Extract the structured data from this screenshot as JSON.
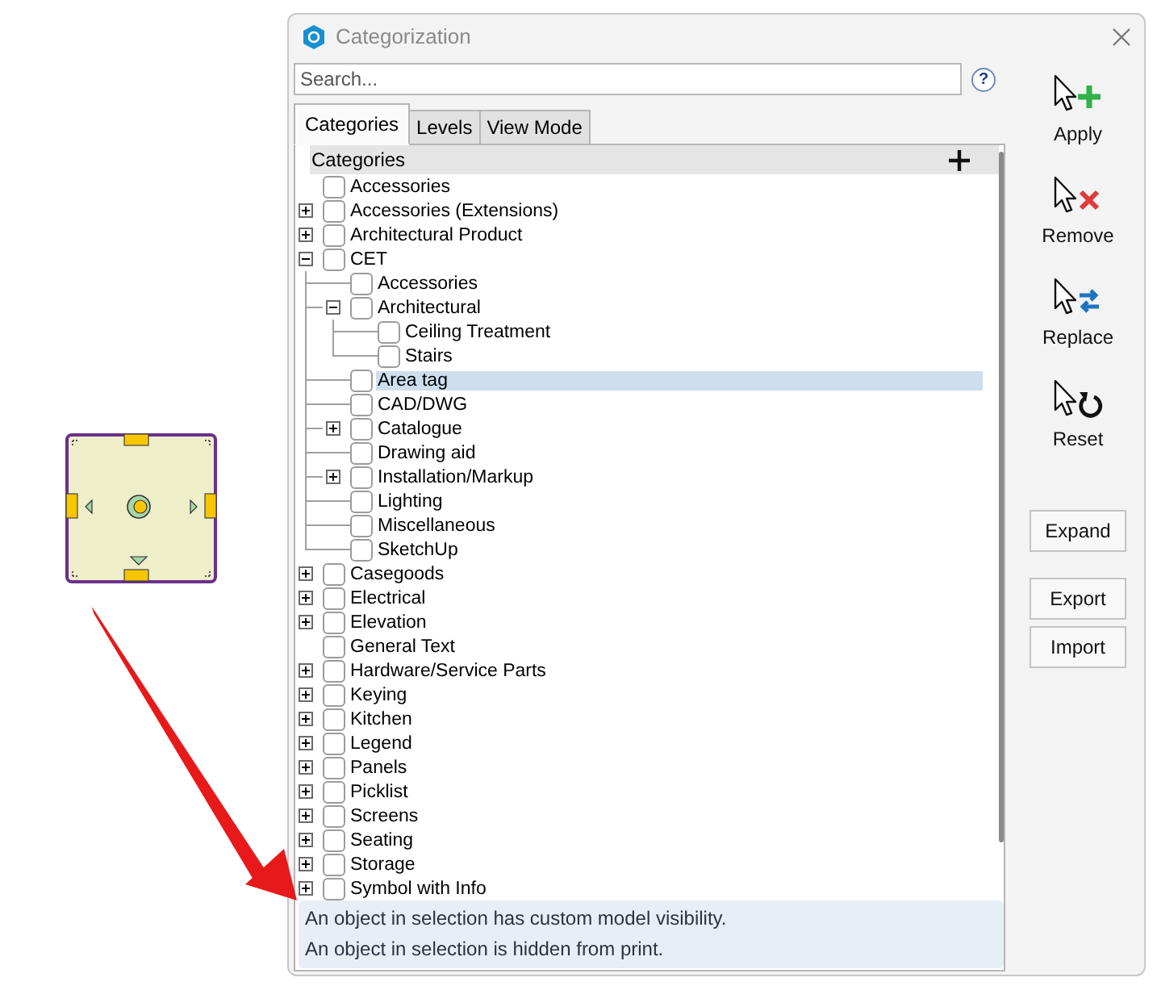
{
  "window": {
    "title": "Categorization"
  },
  "search": {
    "placeholder": "Search..."
  },
  "help_button": {
    "label": "?"
  },
  "tabs": [
    {
      "label": "Categories",
      "selected": true
    },
    {
      "label": "Levels",
      "selected": false
    },
    {
      "label": "View Mode",
      "selected": false
    }
  ],
  "tree": {
    "header": "Categories",
    "items": [
      {
        "label": "Accessories",
        "checked": false,
        "selected": false
      },
      {
        "label": "Accessories (Extensions)",
        "checked": false,
        "selected": false,
        "expanded": false
      },
      {
        "label": "Architectural Product",
        "checked": false,
        "selected": false,
        "expanded": false
      },
      {
        "label": "CET",
        "checked": false,
        "selected": false,
        "expanded": true,
        "children": [
          {
            "label": "Accessories",
            "checked": false,
            "selected": false
          },
          {
            "label": "Architectural",
            "checked": false,
            "selected": false,
            "expanded": true,
            "children": [
              {
                "label": "Ceiling Treatment",
                "checked": false,
                "selected": false
              },
              {
                "label": "Stairs",
                "checked": false,
                "selected": false
              }
            ]
          },
          {
            "label": "Area tag",
            "checked": false,
            "selected": true
          },
          {
            "label": "CAD/DWG",
            "checked": false,
            "selected": false
          },
          {
            "label": "Catalogue",
            "checked": false,
            "selected": false,
            "expanded": false
          },
          {
            "label": "Drawing aid",
            "checked": false,
            "selected": false
          },
          {
            "label": "Installation/Markup",
            "checked": false,
            "selected": false,
            "expanded": false
          },
          {
            "label": "Lighting",
            "checked": false,
            "selected": false
          },
          {
            "label": "Miscellaneous",
            "checked": false,
            "selected": false
          },
          {
            "label": "SketchUp",
            "checked": false,
            "selected": false
          }
        ]
      },
      {
        "label": "Casegoods",
        "checked": false,
        "selected": false,
        "expanded": false
      },
      {
        "label": "Electrical",
        "checked": false,
        "selected": false,
        "expanded": false
      },
      {
        "label": "Elevation",
        "checked": false,
        "selected": false,
        "expanded": false
      },
      {
        "label": "General Text",
        "checked": false,
        "selected": false
      },
      {
        "label": "Hardware/Service Parts",
        "checked": false,
        "selected": false,
        "expanded": false
      },
      {
        "label": "Keying",
        "checked": false,
        "selected": false,
        "expanded": false
      },
      {
        "label": "Kitchen",
        "checked": false,
        "selected": false,
        "expanded": false
      },
      {
        "label": "Legend",
        "checked": false,
        "selected": false,
        "expanded": false
      },
      {
        "label": "Panels",
        "checked": false,
        "selected": false,
        "expanded": false
      },
      {
        "label": "Picklist",
        "checked": false,
        "selected": false,
        "expanded": false
      },
      {
        "label": "Screens",
        "checked": false,
        "selected": false,
        "expanded": false
      },
      {
        "label": "Seating",
        "checked": false,
        "selected": false,
        "expanded": false
      },
      {
        "label": "Storage",
        "checked": false,
        "selected": false,
        "expanded": false
      },
      {
        "label": "Symbol with Info",
        "checked": false,
        "selected": false,
        "expanded": false
      }
    ]
  },
  "status_messages": [
    "An object in selection has custom model visibility.",
    "An object in selection is hidden from print."
  ],
  "actions": [
    {
      "label": "Apply",
      "kind": "apply"
    },
    {
      "label": "Remove",
      "kind": "remove"
    },
    {
      "label": "Replace",
      "kind": "replace"
    },
    {
      "label": "Reset",
      "kind": "reset"
    }
  ],
  "view_buttons": [
    "Expand"
  ],
  "file_buttons": [
    "Export",
    "Import"
  ]
}
